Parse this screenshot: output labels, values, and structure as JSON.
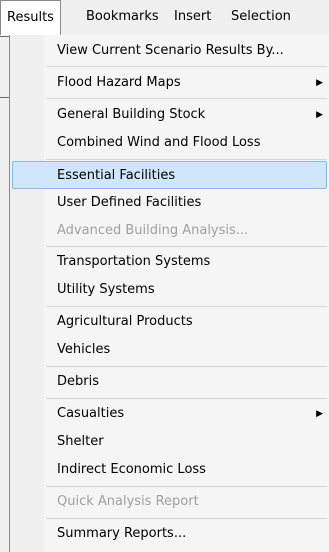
{
  "menubar": {
    "items": [
      {
        "label": "Results",
        "active": true
      },
      {
        "label": "Bookmarks"
      },
      {
        "label": "Insert"
      },
      {
        "label": "Selection"
      }
    ]
  },
  "dropdown": {
    "items": [
      {
        "label": "View Current Scenario Results By..."
      },
      {
        "label": "Flood Hazard Maps",
        "submenu": true
      },
      {
        "label": "General Building Stock",
        "submenu": true
      },
      {
        "label": "Combined Wind and Flood Loss"
      },
      {
        "label": "Essential Facilities",
        "highlighted": true
      },
      {
        "label": "User Defined Facilities"
      },
      {
        "label": "Advanced Building Analysis...",
        "disabled": true
      },
      {
        "label": "Transportation Systems"
      },
      {
        "label": "Utility Systems"
      },
      {
        "label": "Agricultural Products"
      },
      {
        "label": "Vehicles"
      },
      {
        "label": "Debris"
      },
      {
        "label": "Casualties",
        "submenu": true
      },
      {
        "label": "Shelter"
      },
      {
        "label": "Indirect Economic Loss"
      },
      {
        "label": "Quick Analysis Report",
        "disabled": true
      },
      {
        "label": "Summary Reports..."
      }
    ],
    "submenu_arrow_glyph": "▶",
    "highlight_color": "#cfe6fb",
    "disabled_color": "#a0a0a0"
  }
}
